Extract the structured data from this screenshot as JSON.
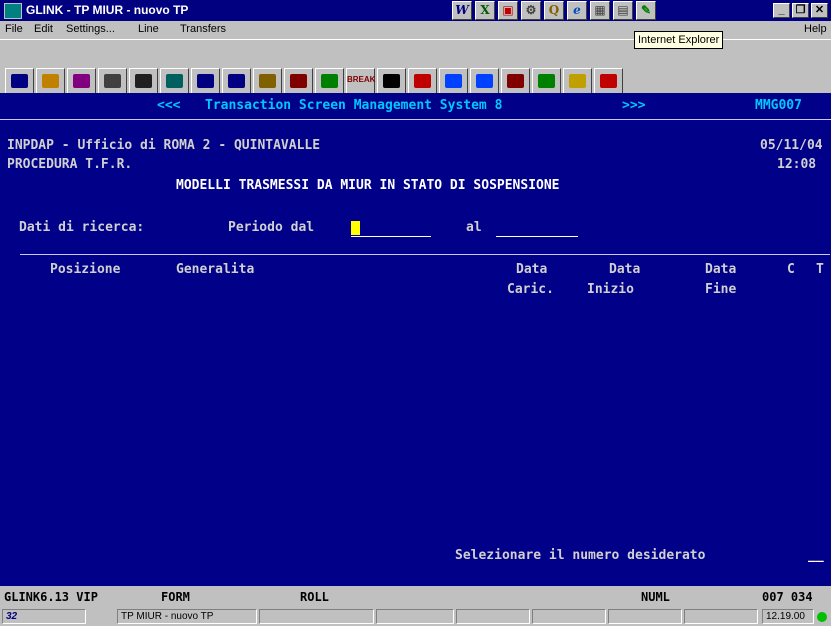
{
  "window": {
    "title": "GLINK - TP MIUR - nuovo TP"
  },
  "titlebar_icons": [
    "W",
    "X",
    "▣",
    "⚙",
    "Q",
    "e",
    "▦",
    "▤",
    "✎"
  ],
  "tooltip": "Internet Explorer",
  "menu": {
    "file": "File",
    "edit": "Edit",
    "settings": "Settings...",
    "line": "Line",
    "transfers": "Transfers",
    "help": "Help"
  },
  "toolbar": {
    "break_label": "BREAK",
    "buttons": [
      "floppy-icon",
      "tools-icon",
      "fax-icon",
      "printer-icon",
      "camera-icon",
      "spy-icon",
      "window-icon",
      "doc-icon",
      "copy-icon",
      "car-icon",
      "down-arrow-icon",
      "break-button",
      "terminal-icon",
      "stop-icon",
      "blue-down-icon",
      "blue-up-icon",
      "wrench-icon",
      "monitor-icon",
      "help-icon",
      "exit-icon"
    ]
  },
  "terminal": {
    "header_prev": "<<<",
    "header_title": "Transaction Screen Management System 8",
    "header_next": ">>>",
    "header_code": "MMG007",
    "org": "INPDAP - Ufficio di ROMA 2 - QUINTAVALLE",
    "date": "05/11/04",
    "procedure": "PROCEDURA T.F.R.",
    "time": "12:08",
    "heading": "MODELLI TRASMESSI DA MIUR IN STATO DI SOSPENSIONE",
    "search_label": "Dati di ricerca:",
    "period_label": "Periodo dal",
    "al_label": "al",
    "col_posizione": "Posizione",
    "col_generalita": "Generalita",
    "col_data1": "Data",
    "col_data1b": "Caric.",
    "col_data2": "Data",
    "col_data2b": "Inizio",
    "col_data3": "Data",
    "col_data3b": "Fine",
    "col_c": "C",
    "col_t": "T",
    "prompt": "Selezionare il numero desiderato",
    "prompt_field": "__"
  },
  "term_status": {
    "session": "GLINK6.13 VIP",
    "mode": "FORM",
    "scroll": "ROLL",
    "numl": "NUML",
    "pos": "007 034"
  },
  "statusbar": {
    "session_name": "TP MIUR - nuovo TP",
    "clock": "12.19.00",
    "badge": "32"
  }
}
